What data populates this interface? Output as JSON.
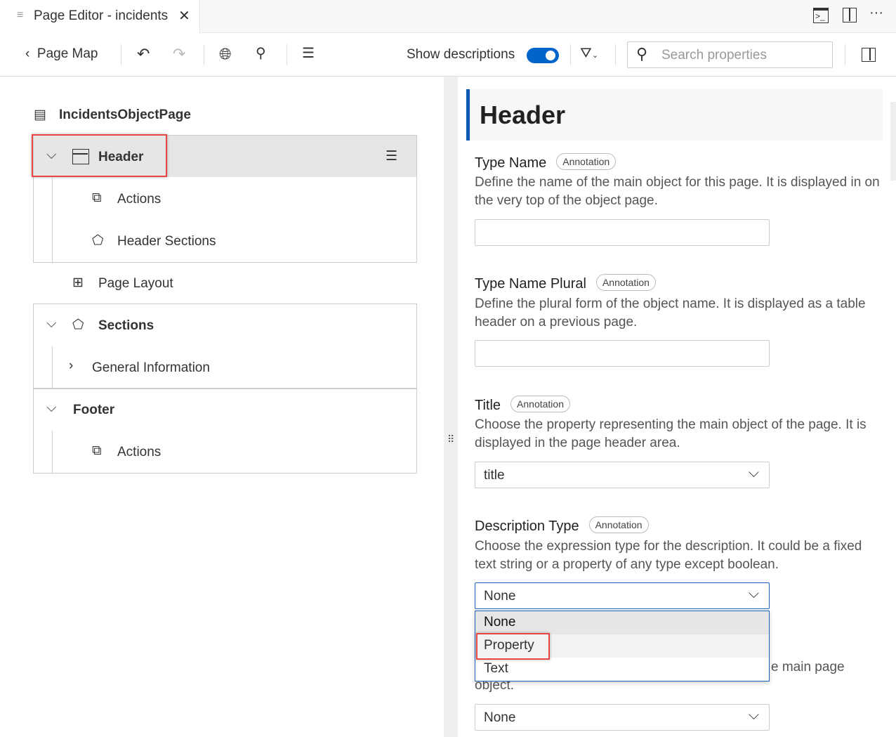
{
  "tab": {
    "title": "Page Editor - incidents",
    "close": "✕"
  },
  "toolbar": {
    "back_label": "Page Map",
    "show_descriptions": "Show descriptions",
    "show_descriptions_on": true,
    "search_placeholder": "Search properties"
  },
  "tree": {
    "root": "IncidentsObjectPage",
    "header": "Header",
    "header_actions": "Actions",
    "header_sections": "Header Sections",
    "page_layout": "Page Layout",
    "sections": "Sections",
    "general_information": "General Information",
    "footer": "Footer",
    "footer_actions": "Actions"
  },
  "panel": {
    "title": "Header",
    "annotation": "Annotation",
    "fields": [
      {
        "label": "Type Name",
        "desc": "Define the name of the main object for this page. It is displayed in on the very top of the object page.",
        "value": ""
      },
      {
        "label": "Type Name Plural",
        "desc": "Define the plural form of the object name. It is displayed as a table header on a previous page.",
        "value": ""
      },
      {
        "label": "Title",
        "desc": "Choose the property representing the main object of the page. It is displayed in the page header area.",
        "value": "title"
      },
      {
        "label": "Description Type",
        "desc": "Choose the expression type for the description. It could be a fixed text string or a property of any type except boolean.",
        "value": "None"
      }
    ],
    "hidden_desc_tail": "e main page",
    "hidden_desc_end": "object.",
    "next_value": "None",
    "dropdown_options": [
      "None",
      "Property",
      "Text"
    ]
  }
}
